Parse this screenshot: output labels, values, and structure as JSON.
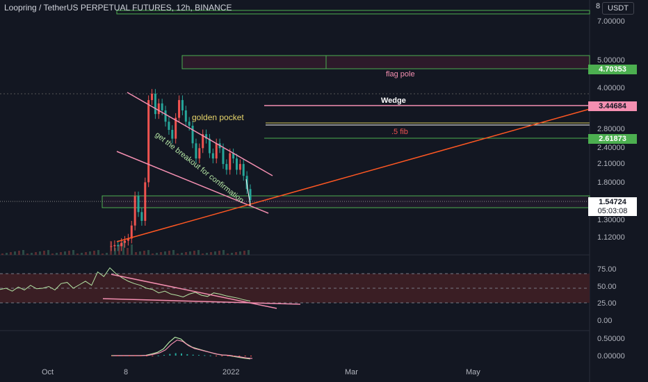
{
  "header": {
    "title": "Loopring / TetherUS PERPETUAL FUTURES, 12h, BINANCE",
    "currency": "USDT",
    "top_tick": "8"
  },
  "colors": {
    "background": "#131722",
    "up": "#ef5350",
    "down": "#26a69a",
    "green_zone": "#4caf50",
    "pink": "#f48fb1",
    "orange_trend": "#ff5722",
    "yellow": "#d4c85c",
    "rsi_band": "#3a1e24",
    "rsi_line": "#b5e6a5"
  },
  "price_axis": {
    "ticks": [
      "7.00000",
      "5.00000",
      "4.00000",
      "2.80000",
      "2.40000",
      "2.10000",
      "1.80000",
      "1.30000",
      "1.12000"
    ]
  },
  "rsi_axis": {
    "ticks": [
      "75.00",
      "50.00",
      "25.00",
      "0.00"
    ]
  },
  "macd_axis": {
    "ticks": [
      "0.50000",
      "0.00000"
    ]
  },
  "time_axis": {
    "ticks": [
      "Oct",
      "8",
      "2022",
      "Mar",
      "May"
    ]
  },
  "price_tags": [
    {
      "label": "4.70353",
      "bg": "#4caf50",
      "color": "#ffffff"
    },
    {
      "label": "3.44684",
      "bg": "#f48fb1",
      "color": "#131722"
    },
    {
      "label": "2.61873",
      "bg": "#4caf50",
      "color": "#ffffff"
    },
    {
      "label": "1.54724",
      "bg": "#ffffff",
      "color": "#131722"
    },
    {
      "label": "05:03:08",
      "bg": "#ffffff",
      "color": "#131722"
    }
  ],
  "annotations": {
    "flag_pole": "flag pole",
    "wedge": "Wedge",
    "golden_pocket": "golden pocket",
    "fib": ".5 fib",
    "breakout": "get the breakout for confirmation"
  },
  "chart_data": [
    {
      "type": "line",
      "title": "Loopring / TetherUS PERPETUAL FUTURES, 12h, BINANCE",
      "description_series": "LRC price (candlestick)",
      "y_scale": "log",
      "last_price": 1.54724,
      "countdown": "05:03:08",
      "levels": [
        {
          "label": "flag pole",
          "value": 4.70353
        },
        {
          "label": "Wedge",
          "value": 3.44684
        },
        {
          "label": ".5 fib",
          "value": 2.61873
        }
      ],
      "x_ticks": [
        "Oct",
        "8",
        "2022",
        "Mar",
        "May"
      ],
      "series": [
        {
          "values": [
            1.05,
            1.06,
            1.05,
            1.08,
            1.1,
            1.12,
            1.25,
            1.6,
            1.4,
            1.3,
            1.8,
            3.6,
            3.8,
            3.2,
            3.5,
            3.3,
            3.0,
            2.8,
            2.6,
            3.1,
            3.6,
            3.3,
            3.0,
            2.9,
            2.5,
            2.2,
            2.4,
            2.7,
            2.6,
            2.3,
            2.2,
            2.5,
            2.4,
            2.1,
            2.0,
            2.3,
            2.2,
            2.0,
            2.1,
            1.9,
            1.7,
            1.55
          ]
        }
      ]
    },
    {
      "type": "line",
      "indicator": "RSI",
      "y_ticks": [
        75,
        50,
        25,
        0
      ],
      "series": [
        {
          "values": [
            48,
            50,
            45,
            52,
            47,
            55,
            49,
            50,
            53,
            47,
            58,
            60,
            50,
            56,
            62,
            55,
            78,
            70,
            85,
            75,
            68,
            62,
            58,
            55,
            50,
            48,
            42,
            45,
            40,
            38,
            35,
            40,
            43,
            38,
            36,
            42,
            40,
            37,
            35,
            33,
            30,
            28
          ]
        }
      ]
    },
    {
      "type": "line",
      "indicator": "MACD",
      "y_ticks": [
        0.5,
        0.0
      ],
      "series": [
        {
          "values": [
            0,
            0,
            0,
            0,
            0,
            0,
            0.01,
            0.05,
            0.1,
            0.2,
            0.4,
            0.55,
            0.5,
            0.35,
            0.25,
            0.2,
            0.15,
            0.1,
            0.05,
            0.02,
            0.01,
            -0.02,
            -0.05,
            -0.08,
            -0.1
          ]
        }
      ]
    }
  ]
}
